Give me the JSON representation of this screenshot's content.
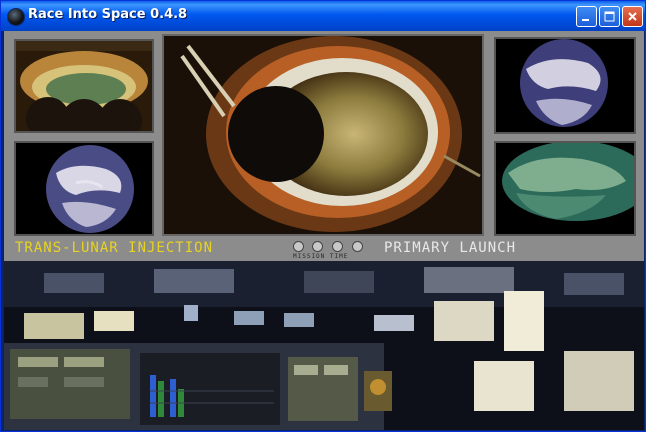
{
  "window": {
    "title": "Race Into Space 0.4.8",
    "icon": "app-icon",
    "controls": [
      "minimize-icon",
      "maximize-icon",
      "close-icon"
    ]
  },
  "game": {
    "left_status": "TRANS-LUNAR INJECTION",
    "right_status": "PRIMARY LAUNCH",
    "mission_time_label": "MISSION TIME",
    "colors": {
      "status_yellow": "#e8d320",
      "status_white": "#e8e8e8",
      "panel_grey": "#8c8c8c",
      "titlebar_blue": "#0058ee"
    }
  }
}
